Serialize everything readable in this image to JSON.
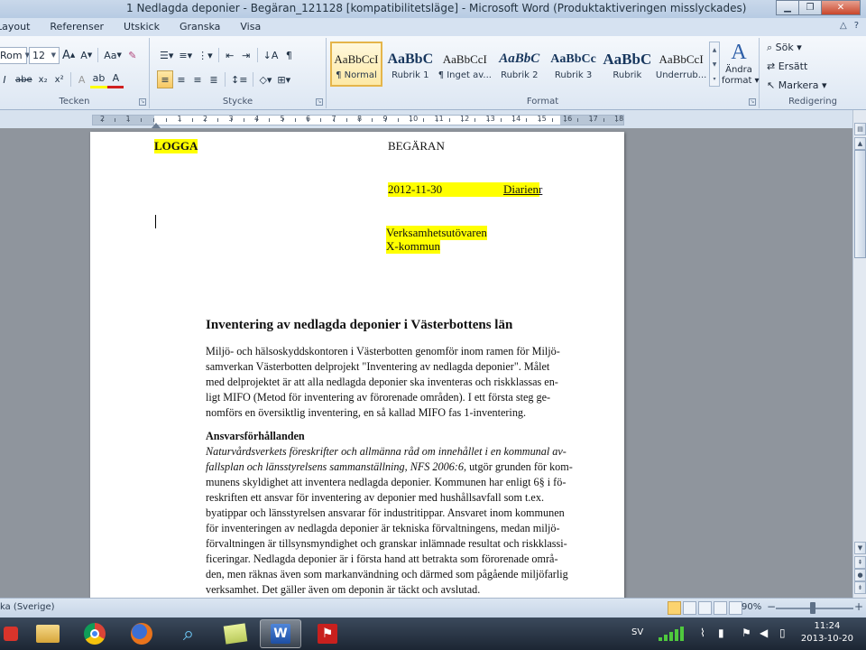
{
  "window": {
    "title": "1 Nedlagda deponier - Begäran_121128 [kompatibilitetsläge] - Microsoft Word (Produktaktiveringen misslyckades)"
  },
  "tabs": [
    "Layout",
    "Referenser",
    "Utskick",
    "Granska",
    "Visa"
  ],
  "ribbon": {
    "font": {
      "name": "Rom",
      "size": "12",
      "grow": "A",
      "shrink": "A",
      "change_case": "Aa",
      "label": "Tecken"
    },
    "paragraph": {
      "label": "Stycke"
    },
    "styles": {
      "items": [
        {
          "sample": "AaBbCcI",
          "name": "¶ Normal"
        },
        {
          "sample": "AaBbC",
          "name": "Rubrik 1"
        },
        {
          "sample": "AaBbCcI",
          "name": "¶ Inget av..."
        },
        {
          "sample": "AaBbC",
          "name": "Rubrik 2"
        },
        {
          "sample": "AaBbCc",
          "name": "Rubrik 3"
        },
        {
          "sample": "AaBbC",
          "name": "Rubrik"
        },
        {
          "sample": "AaBbCcI",
          "name": "Underrub..."
        }
      ],
      "change_styles_line1": "Ändra",
      "change_styles_line2": "format",
      "label": "Format"
    },
    "editing": {
      "find": "Sök",
      "replace": "Ersätt",
      "select": "Markera",
      "label": "Redigering"
    }
  },
  "ruler": {
    "numbers": [
      "2",
      "1",
      "1",
      "2",
      "3",
      "4",
      "5",
      "6",
      "7",
      "8",
      "9",
      "10",
      "11",
      "12",
      "13",
      "14",
      "15",
      "16",
      "17",
      "18"
    ]
  },
  "document": {
    "logo": "LOGGA",
    "request": "BEGÄRAN",
    "date": "2012-11-30",
    "diarie": "Diarienr",
    "recipient1": "Verksamhetsutövaren",
    "recipient2": "X-kommun",
    "heading": "Inventering av nedlagda deponier i Västerbottens län",
    "intro": [
      "Miljö- och hälsoskyddskontoren i Västerbotten genomför inom ramen för Miljö-",
      "samverkan Västerbotten delprojekt \"Inventering av nedlagda deponier\". Målet",
      "med delprojektet är att alla nedlagda deponier ska inventeras och riskklassas en-",
      "ligt MIFO (Metod för inventering av förorenade områden). I ett första steg ge-",
      "nomförs en översiktlig inventering, en så kallad MIFO fas 1-inventering."
    ],
    "subheading": "Ansvarsförhållanden",
    "body_italic_1": "Naturvårdsverkets föreskrifter och allmänna råd om innehållet i en kommunal av-",
    "body_italic_2": "fallsplan och länsstyrelsens sammanställning, NFS 2006:6",
    "body_tail_2": ", utgör grunden för kom-",
    "body": [
      "munens skyldighet att inventera nedlagda deponier. Kommunen har enligt 6§ i fö-",
      "reskriften ett ansvar för inventering av deponier med hushållsavfall som t.ex.",
      "byatippar och länsstyrelsen ansvarar för industritippar. Ansvaret inom kommunen",
      "för inventeringen av nedlagda deponier är tekniska förvaltningens, medan miljö-",
      "förvaltningen är tillsynsmyndighet och granskar inlämnade resultat och riskklassi-",
      "ficeringar. Nedlagda deponier är i första hand att betrakta som förorenade områ-",
      "den, men räknas även som markanvändning och därmed som pågående miljöfarlig",
      "verksamhet. Det gäller även om deponin är täckt och avslutad."
    ]
  },
  "statusbar": {
    "language": "ka (Sverige)",
    "zoom": "90%"
  },
  "taskbar": {
    "lang": "SV",
    "time": "11:24",
    "date": "2013-10-20"
  },
  "colors": {
    "highlight": "#ffff00",
    "ribbon_bg": "#dde7f3",
    "active_style": "#fde9a6"
  }
}
